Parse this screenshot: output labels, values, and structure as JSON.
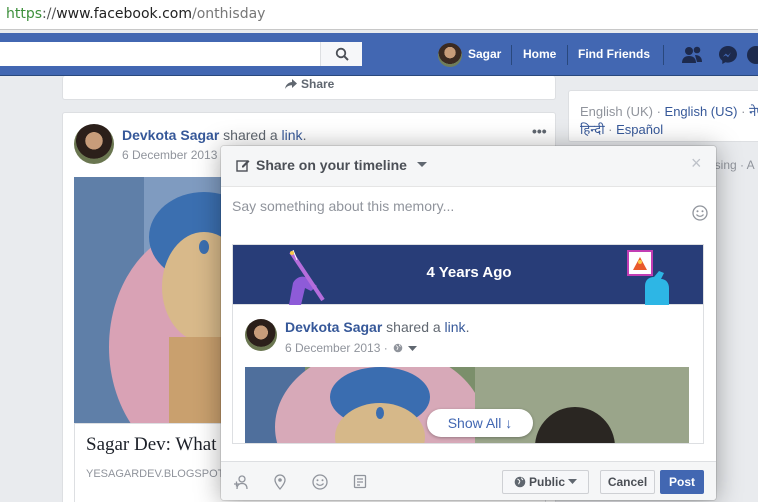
{
  "browser": {
    "url_scheme": "https",
    "url_sep": "://",
    "url_host": "www.facebook.com",
    "url_path": "/onthisday"
  },
  "topbar": {
    "user_name": "Sagar",
    "home": "Home",
    "find_friends": "Find Friends"
  },
  "feed": {
    "share_label": "Share",
    "post": {
      "author": "Devkota Sagar",
      "verb": "shared a",
      "object": "link",
      "period": ".",
      "date": "6 December 2013",
      "link_title": "Sagar Dev: What",
      "link_domain": "YESAGARDEV.BLOGSPOT"
    }
  },
  "right_column": {
    "current_language": "English (UK)",
    "sep1": " · ",
    "lang2": "English (US)",
    "sep2": " · ",
    "lang3": "नेप",
    "lang4": "हिन्दी",
    "sep3": " · ",
    "lang5": "Español",
    "advertising_fragment": "ising · A"
  },
  "modal": {
    "title": "Share on your timeline",
    "close": "×",
    "compose_placeholder": "Say something about this memory...",
    "banner_text": "4 Years Ago",
    "post": {
      "author": "Devkota Sagar",
      "verb": "shared a",
      "object": "link",
      "period": ".",
      "date": "6 December 2013 ·"
    },
    "show_all": "Show All ↓",
    "footer": {
      "audience": "Public",
      "cancel": "Cancel",
      "post": "Post"
    }
  },
  "colors": {
    "brand_blue": "#4267b2",
    "banner_navy": "#283d78",
    "link": "#365899"
  }
}
